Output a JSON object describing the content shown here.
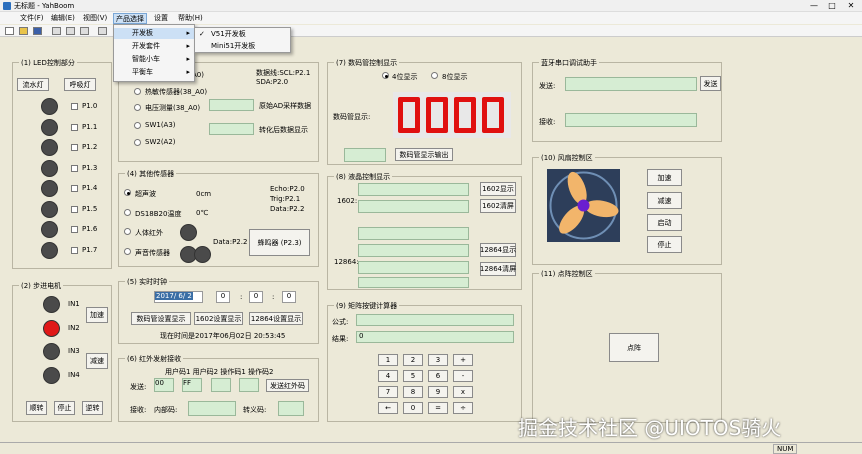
{
  "window": {
    "title": "无标题 - YahBoom",
    "minimize": "—",
    "maximize": "□",
    "close": "✕"
  },
  "menu": [
    "文件(F)",
    "编辑(E)",
    "视图(V)",
    "产品选择",
    "设置",
    "帮助(H)"
  ],
  "dropdown": {
    "items": [
      "开发板",
      "开发套件",
      "智能小车",
      "平衡车"
    ],
    "arrow": "▸",
    "submenu": {
      "check": "✓",
      "items": [
        "V51开发板",
        "Mini51开发板"
      ]
    }
  },
  "led": {
    "title": "(1) LED控制部分",
    "flow_button": "流水灯",
    "breath_button": "呼吸灯",
    "pins": [
      "P1.0",
      "P1.1",
      "P1.2",
      "P1.3",
      "P1.4",
      "P1.5",
      "P1.6",
      "P1.7"
    ]
  },
  "motor": {
    "title": "(2) 步进电机",
    "pins": [
      "IN1",
      "IN2",
      "IN3",
      "IN4"
    ],
    "accel": "加速",
    "decel": "减速",
    "cw": "顺转",
    "stop": "停止",
    "ccw": "逆转"
  },
  "sensors": {
    "opt0": "热敏传感器(38_A0)",
    "opt1": "电压测量(38_A0)",
    "opt2": "SW1(A3)",
    "opt3": "SW2(A2)",
    "partial": "A0)",
    "bus_info": "数据线:SCL:P2.1\nSDA:P2.0",
    "ad_label": "原始AD采样数据",
    "conv_label": "转化后数据显示"
  },
  "other": {
    "title": "(4) 其他传感器",
    "ultra": "超声波",
    "ultra_val": "0cm",
    "ultra_pins": "Echo:P2.0\nTrig:P2.1\nData:P2.2",
    "ds18": "DS18B20温度",
    "ds18_val": "0℃",
    "ir": "人体红外",
    "sound": "声音传感器",
    "data_pin": "Data:P2.2",
    "buzzer": "蜂鸣器 (P2.3)"
  },
  "rtc": {
    "title": "(5) 实时时钟",
    "date": "2017/ 6/ 2",
    "h": "0",
    "m": "0",
    "s": "0",
    "sep": ":",
    "btn_seg": "数码管设置显示",
    "btn_1602": "1602设置显示",
    "btn_12864": "12864设置显示",
    "now": "现在时间是2017年06月02日 20:53:45"
  },
  "irc": {
    "title": "(6) 红外发射接收",
    "headers": "用户码1 用户码2 操作码1 操作码2",
    "send_label": "发送:",
    "v1": "00",
    "v2": "FF",
    "send_btn": "发送红外码",
    "recv_label": "接收:",
    "inner_label": "内部码:",
    "conv_label": "转义码:"
  },
  "seg": {
    "title": "(7) 数码管控制显示",
    "r4": "4位显示",
    "r8": "8位显示",
    "label": "数码管显示:",
    "output": "数码管显示输出"
  },
  "lcd": {
    "title": "(8) 液晶控制显示",
    "l1602": "1602:",
    "b1602": "1602显示",
    "c1602": "1602清屏",
    "l12864": "12864:",
    "b12864": "12864显示",
    "c12864": "12864清屏"
  },
  "calc": {
    "title": "(9) 矩阵按键计算器",
    "formula": "公式:",
    "result": "结果:",
    "result_val": "0",
    "keys": [
      "1",
      "2",
      "3",
      "+",
      "4",
      "5",
      "6",
      "-",
      "7",
      "8",
      "9",
      "x",
      "←",
      "0",
      "=",
      "÷"
    ]
  },
  "bt": {
    "title": "蓝牙串口调试助手",
    "send": "发送:",
    "send_btn": "发送",
    "recv": "接收:"
  },
  "fan": {
    "title": "(10) 风扇控制区",
    "b1": "加速",
    "b2": "减速",
    "b3": "启动",
    "b4": "停止"
  },
  "dot": {
    "title": "(11) 点阵控制区",
    "btn": "点阵"
  },
  "status": {
    "num": "NUM"
  },
  "watermark": "掘金技术社区 @UIOTOS骑火"
}
